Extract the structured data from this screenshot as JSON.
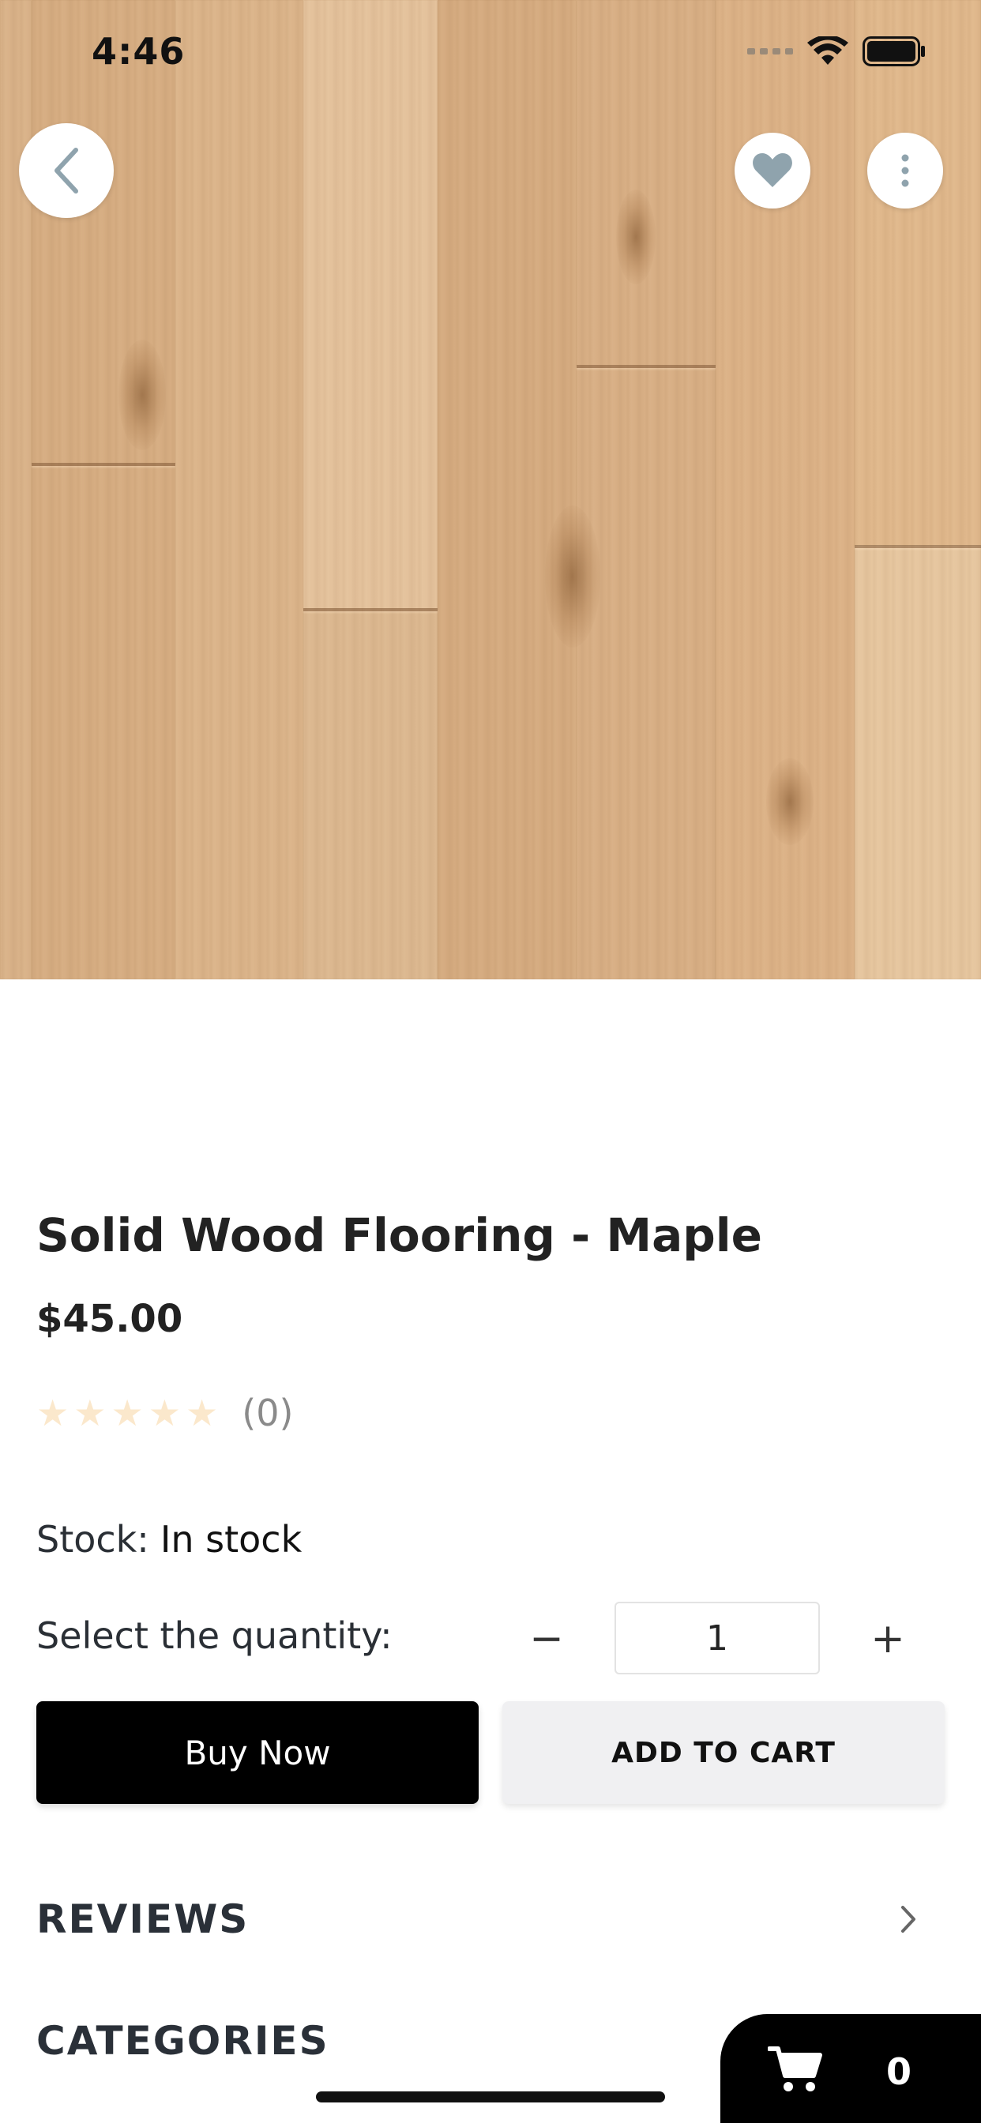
{
  "status_bar": {
    "time": "4:46",
    "icons": [
      "signal-icon",
      "wifi-icon",
      "battery-icon"
    ]
  },
  "nav": {
    "back_icon": "chevron-left-icon",
    "favorite_icon": "heart-icon",
    "more_icon": "more-vertical-icon"
  },
  "product": {
    "title": "Solid Wood Flooring - Maple",
    "price": "$45.00",
    "rating": 0,
    "rating_max": 5,
    "rating_count": "(0)",
    "stock_label": "Stock:",
    "stock_value": "In stock"
  },
  "quantity": {
    "label": "Select the quantity:",
    "minus": "−",
    "value": "1",
    "plus": "+"
  },
  "actions": {
    "buy_now": "Buy Now",
    "add_to_cart": "ADD TO CART"
  },
  "sections": {
    "reviews": "REVIEWS",
    "categories": "CATEGORIES"
  },
  "cart": {
    "icon": "cart-icon",
    "count": "0"
  },
  "colors": {
    "primary_button": "#000000",
    "secondary_button": "#f0f0f2",
    "star_empty": "#fbe8cc",
    "heart_icon": "#8fa3ad",
    "wood": "#d8ae82"
  }
}
